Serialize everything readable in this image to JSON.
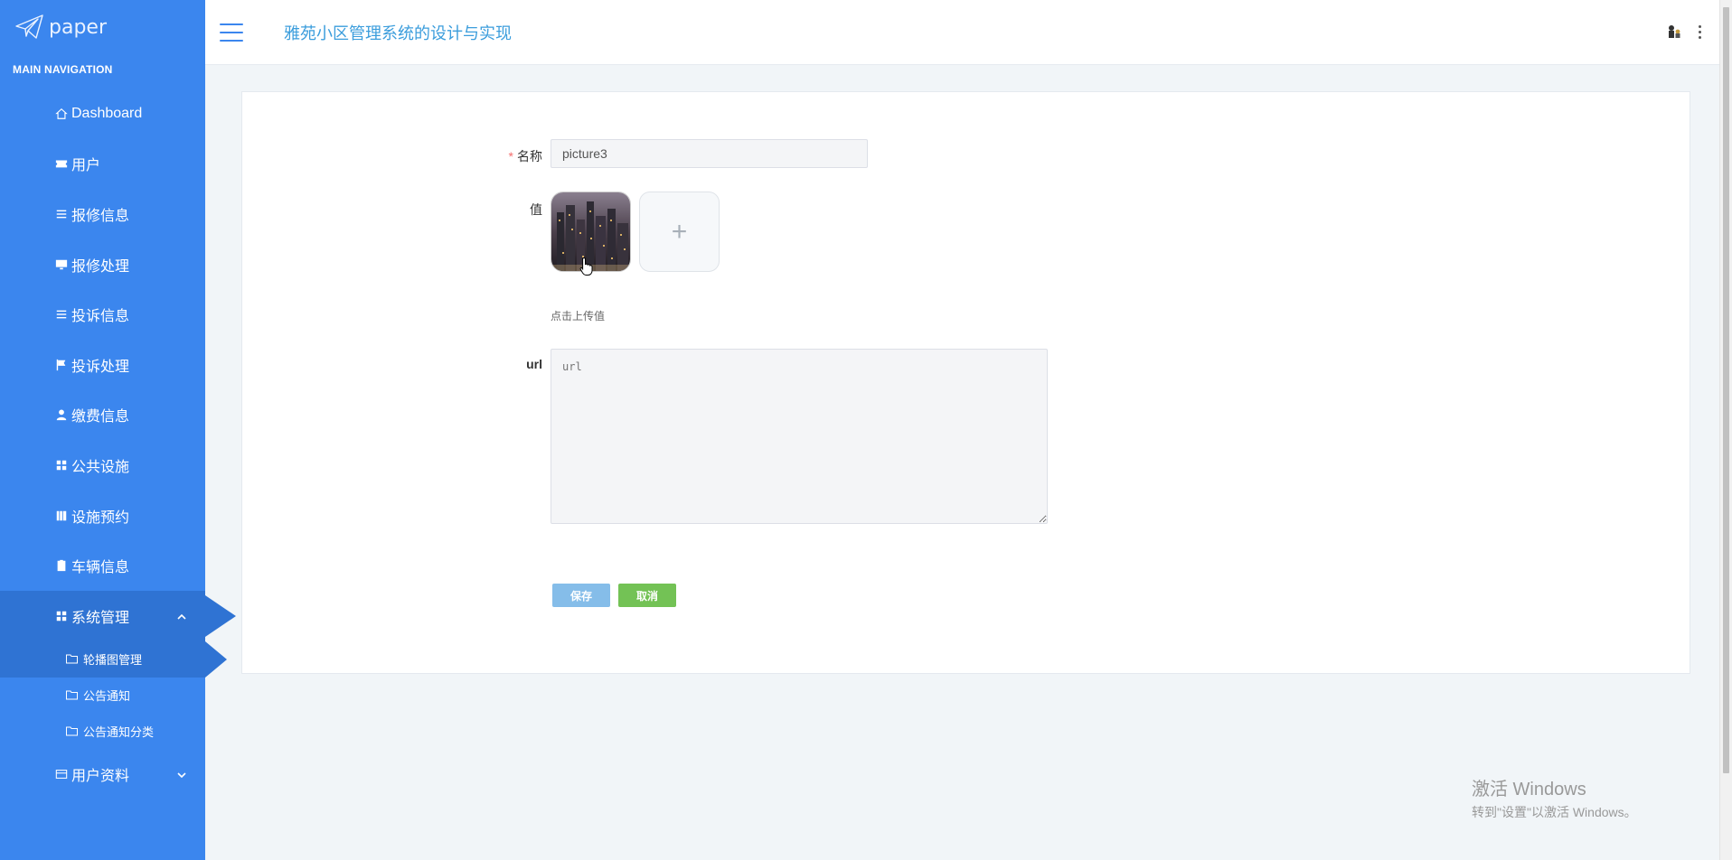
{
  "brand": {
    "logo_text": "paper"
  },
  "sidebar": {
    "header": "MAIN NAVIGATION",
    "items": [
      {
        "label": "Dashboard",
        "icon": "home-icon"
      },
      {
        "label": "用户",
        "icon": "ticket-icon"
      },
      {
        "label": "报修信息",
        "icon": "list-icon"
      },
      {
        "label": "报修处理",
        "icon": "monitor-icon"
      },
      {
        "label": "投诉信息",
        "icon": "list-icon"
      },
      {
        "label": "投诉处理",
        "icon": "flag-icon"
      },
      {
        "label": "缴费信息",
        "icon": "user-icon"
      },
      {
        "label": "公共设施",
        "icon": "grid-icon"
      },
      {
        "label": "设施预约",
        "icon": "book-icon"
      },
      {
        "label": "车辆信息",
        "icon": "clipboard-icon"
      },
      {
        "label": "系统管理",
        "icon": "grid-icon"
      }
    ],
    "sub_items": [
      {
        "label": "轮播图管理",
        "icon": "folder-icon"
      },
      {
        "label": "公告通知",
        "icon": "folder-icon"
      },
      {
        "label": "公告通知分类",
        "icon": "folder-icon"
      }
    ],
    "tail_item": {
      "label": "用户资料",
      "icon": "card-icon"
    }
  },
  "header": {
    "title": "雅苑小区管理系统的设计与实现"
  },
  "form": {
    "name_label": "名称",
    "name_value": "picture3",
    "value_label": "值",
    "upload_hint": "点击上传值",
    "url_label": "url",
    "url_placeholder": "url",
    "save_label": "保存",
    "cancel_label": "取消"
  },
  "watermark": {
    "line1": "激活 Windows",
    "line2": "转到\"设置\"以激活 Windows。"
  },
  "colors": {
    "sidebar": "#3b86ee",
    "sidebar_active": "#2f73d3",
    "title": "#3b9ddc",
    "save": "#85bde9",
    "cancel": "#73c255"
  }
}
